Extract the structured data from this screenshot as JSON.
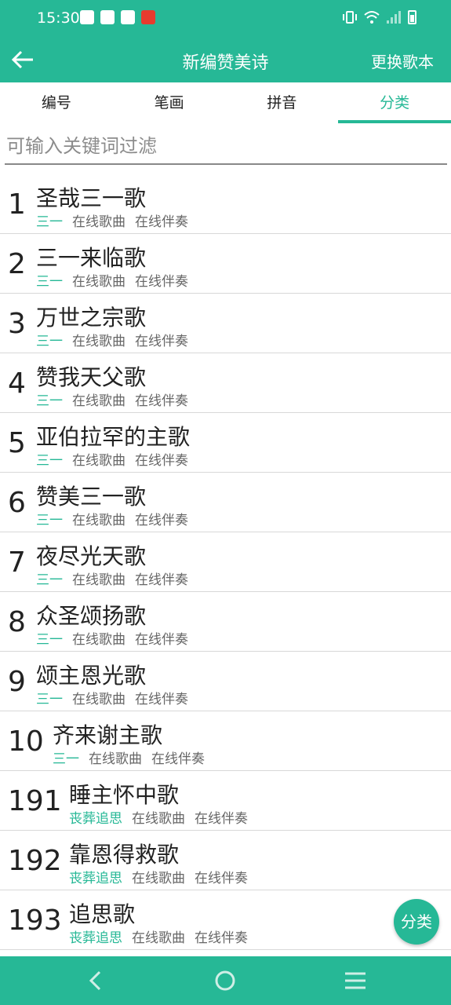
{
  "status_bar": {
    "time": "15:30",
    "notification_icons": [
      "bag-icon",
      "compass-icon",
      "book-icon",
      "apple-icon"
    ],
    "system_icons": [
      "vibrate-icon",
      "wifi-icon",
      "signal-icon",
      "battery-icon"
    ]
  },
  "app_bar": {
    "title": "新编赞美诗",
    "action_label": "更换歌本"
  },
  "tabs": [
    {
      "label": "编号",
      "active": false
    },
    {
      "label": "笔画",
      "active": false
    },
    {
      "label": "拼音",
      "active": false
    },
    {
      "label": "分类",
      "active": true
    }
  ],
  "filter": {
    "placeholder": "可输入关键词过滤",
    "value": ""
  },
  "songs": [
    {
      "number": "1",
      "title": "圣哉三一歌",
      "category": "三一",
      "online_song": "在线歌曲",
      "online_accompaniment": "在线伴奏"
    },
    {
      "number": "2",
      "title": "三一来临歌",
      "category": "三一",
      "online_song": "在线歌曲",
      "online_accompaniment": "在线伴奏"
    },
    {
      "number": "3",
      "title": "万世之宗歌",
      "category": "三一",
      "online_song": "在线歌曲",
      "online_accompaniment": "在线伴奏"
    },
    {
      "number": "4",
      "title": "赞我天父歌",
      "category": "三一",
      "online_song": "在线歌曲",
      "online_accompaniment": "在线伴奏"
    },
    {
      "number": "5",
      "title": "亚伯拉罕的主歌",
      "category": "三一",
      "online_song": "在线歌曲",
      "online_accompaniment": "在线伴奏"
    },
    {
      "number": "6",
      "title": "赞美三一歌",
      "category": "三一",
      "online_song": "在线歌曲",
      "online_accompaniment": "在线伴奏"
    },
    {
      "number": "7",
      "title": "夜尽光天歌",
      "category": "三一",
      "online_song": "在线歌曲",
      "online_accompaniment": "在线伴奏"
    },
    {
      "number": "8",
      "title": "众圣颂扬歌",
      "category": "三一",
      "online_song": "在线歌曲",
      "online_accompaniment": "在线伴奏"
    },
    {
      "number": "9",
      "title": "颂主恩光歌",
      "category": "三一",
      "online_song": "在线歌曲",
      "online_accompaniment": "在线伴奏"
    },
    {
      "number": "10",
      "title": "齐来谢主歌",
      "category": "三一",
      "online_song": "在线歌曲",
      "online_accompaniment": "在线伴奏"
    },
    {
      "number": "191",
      "title": "睡主怀中歌",
      "category": "丧葬追思",
      "online_song": "在线歌曲",
      "online_accompaniment": "在线伴奏"
    },
    {
      "number": "192",
      "title": "靠恩得救歌",
      "category": "丧葬追思",
      "online_song": "在线歌曲",
      "online_accompaniment": "在线伴奏"
    },
    {
      "number": "193",
      "title": "追思歌",
      "category": "丧葬追思",
      "online_song": "在线歌曲",
      "online_accompaniment": "在线伴奏"
    }
  ],
  "fab": {
    "label": "分类"
  },
  "nav_bar": {
    "buttons": [
      "back-nav-icon",
      "home-nav-icon",
      "menu-nav-icon"
    ]
  },
  "colors": {
    "primary": "#26b896",
    "text": "#222222",
    "secondary_text": "#666666"
  }
}
